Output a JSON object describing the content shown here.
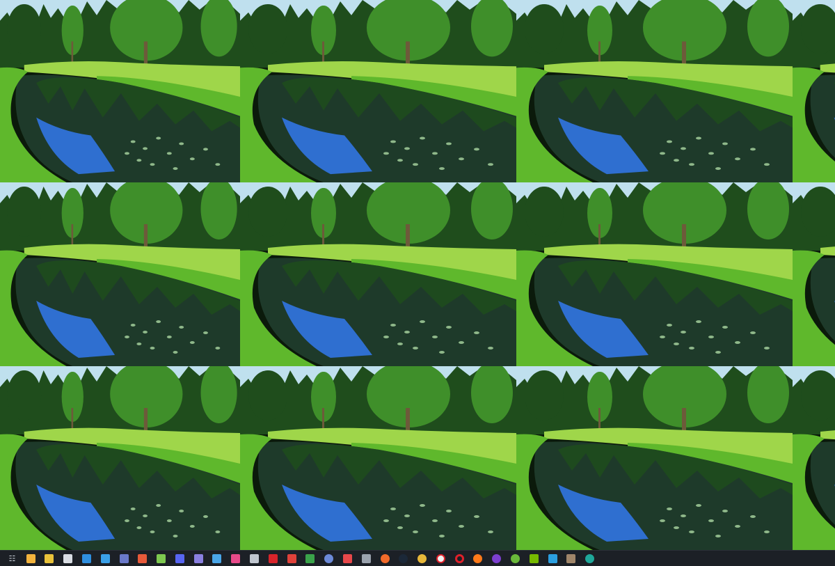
{
  "screen": {
    "wallpaper": {
      "description_name": "forest-pond-tiled",
      "rows": 3,
      "columns": 4,
      "colors": {
        "sky": "#bfe0ee",
        "trees_dark": "#1f4d1c",
        "trees_light": "#3f8f2a",
        "grass": "#5fb82c",
        "grass_light": "#9fd64a",
        "water": "#1e3a2a",
        "water_blue": "#2f6fd0",
        "lily": "#8fb88a"
      }
    },
    "taskbar": {
      "background": "#1c2026",
      "items": [
        {
          "name": "task-view-icon",
          "color": "#cfd6df"
        },
        {
          "name": "file-explorer-icon",
          "color": "#f2b33d"
        },
        {
          "name": "folder-icon",
          "color": "#e8c23a"
        },
        {
          "name": "pet-app-icon",
          "color": "#d9dde3"
        },
        {
          "name": "document-icon",
          "color": "#2f8fe0"
        },
        {
          "name": "calculator-icon",
          "color": "#3aa0e8"
        },
        {
          "name": "shield-icon",
          "color": "#6a79c9"
        },
        {
          "name": "store-icon",
          "color": "#e85a3a"
        },
        {
          "name": "cube-icon",
          "color": "#7ec850"
        },
        {
          "name": "discord-icon",
          "color": "#5865f2"
        },
        {
          "name": "user-account-icon",
          "color": "#8a7fe0"
        },
        {
          "name": "display-icon",
          "color": "#4aa6e8"
        },
        {
          "name": "pinwheel-icon",
          "color": "#e84a8a"
        },
        {
          "name": "tools-icon",
          "color": "#c0c6cf"
        },
        {
          "name": "oval-app-icon",
          "color": "#d8242a"
        },
        {
          "name": "maps-pin-icon",
          "color": "#e0423a"
        },
        {
          "name": "tiles-icon",
          "color": "#3aa34a"
        },
        {
          "name": "globe-icon",
          "color": "#6c8ad8"
        },
        {
          "name": "mail-icon",
          "color": "#e8484a"
        },
        {
          "name": "dropper-icon",
          "color": "#9aa2ad"
        },
        {
          "name": "brave-browser-icon",
          "color": "#f26a2a"
        },
        {
          "name": "steam-icon",
          "color": "#1b2838"
        },
        {
          "name": "chrome-icon",
          "color": "#e8b83a"
        },
        {
          "name": "yandex-browser-icon",
          "color": "#f1f1f1"
        },
        {
          "name": "opera-icon",
          "color": "#e0202a"
        },
        {
          "name": "firefox-icon",
          "color": "#ff7a1a"
        },
        {
          "name": "tor-browser-icon",
          "color": "#7d3fd0"
        },
        {
          "name": "torrent-client-icon",
          "color": "#6ab83a"
        },
        {
          "name": "nvidia-icon",
          "color": "#76b900"
        },
        {
          "name": "photo-viewer-icon",
          "color": "#2b9fe0"
        },
        {
          "name": "image-editor-icon",
          "color": "#a0866a"
        },
        {
          "name": "update-app-icon",
          "color": "#1fa89a"
        }
      ]
    }
  }
}
